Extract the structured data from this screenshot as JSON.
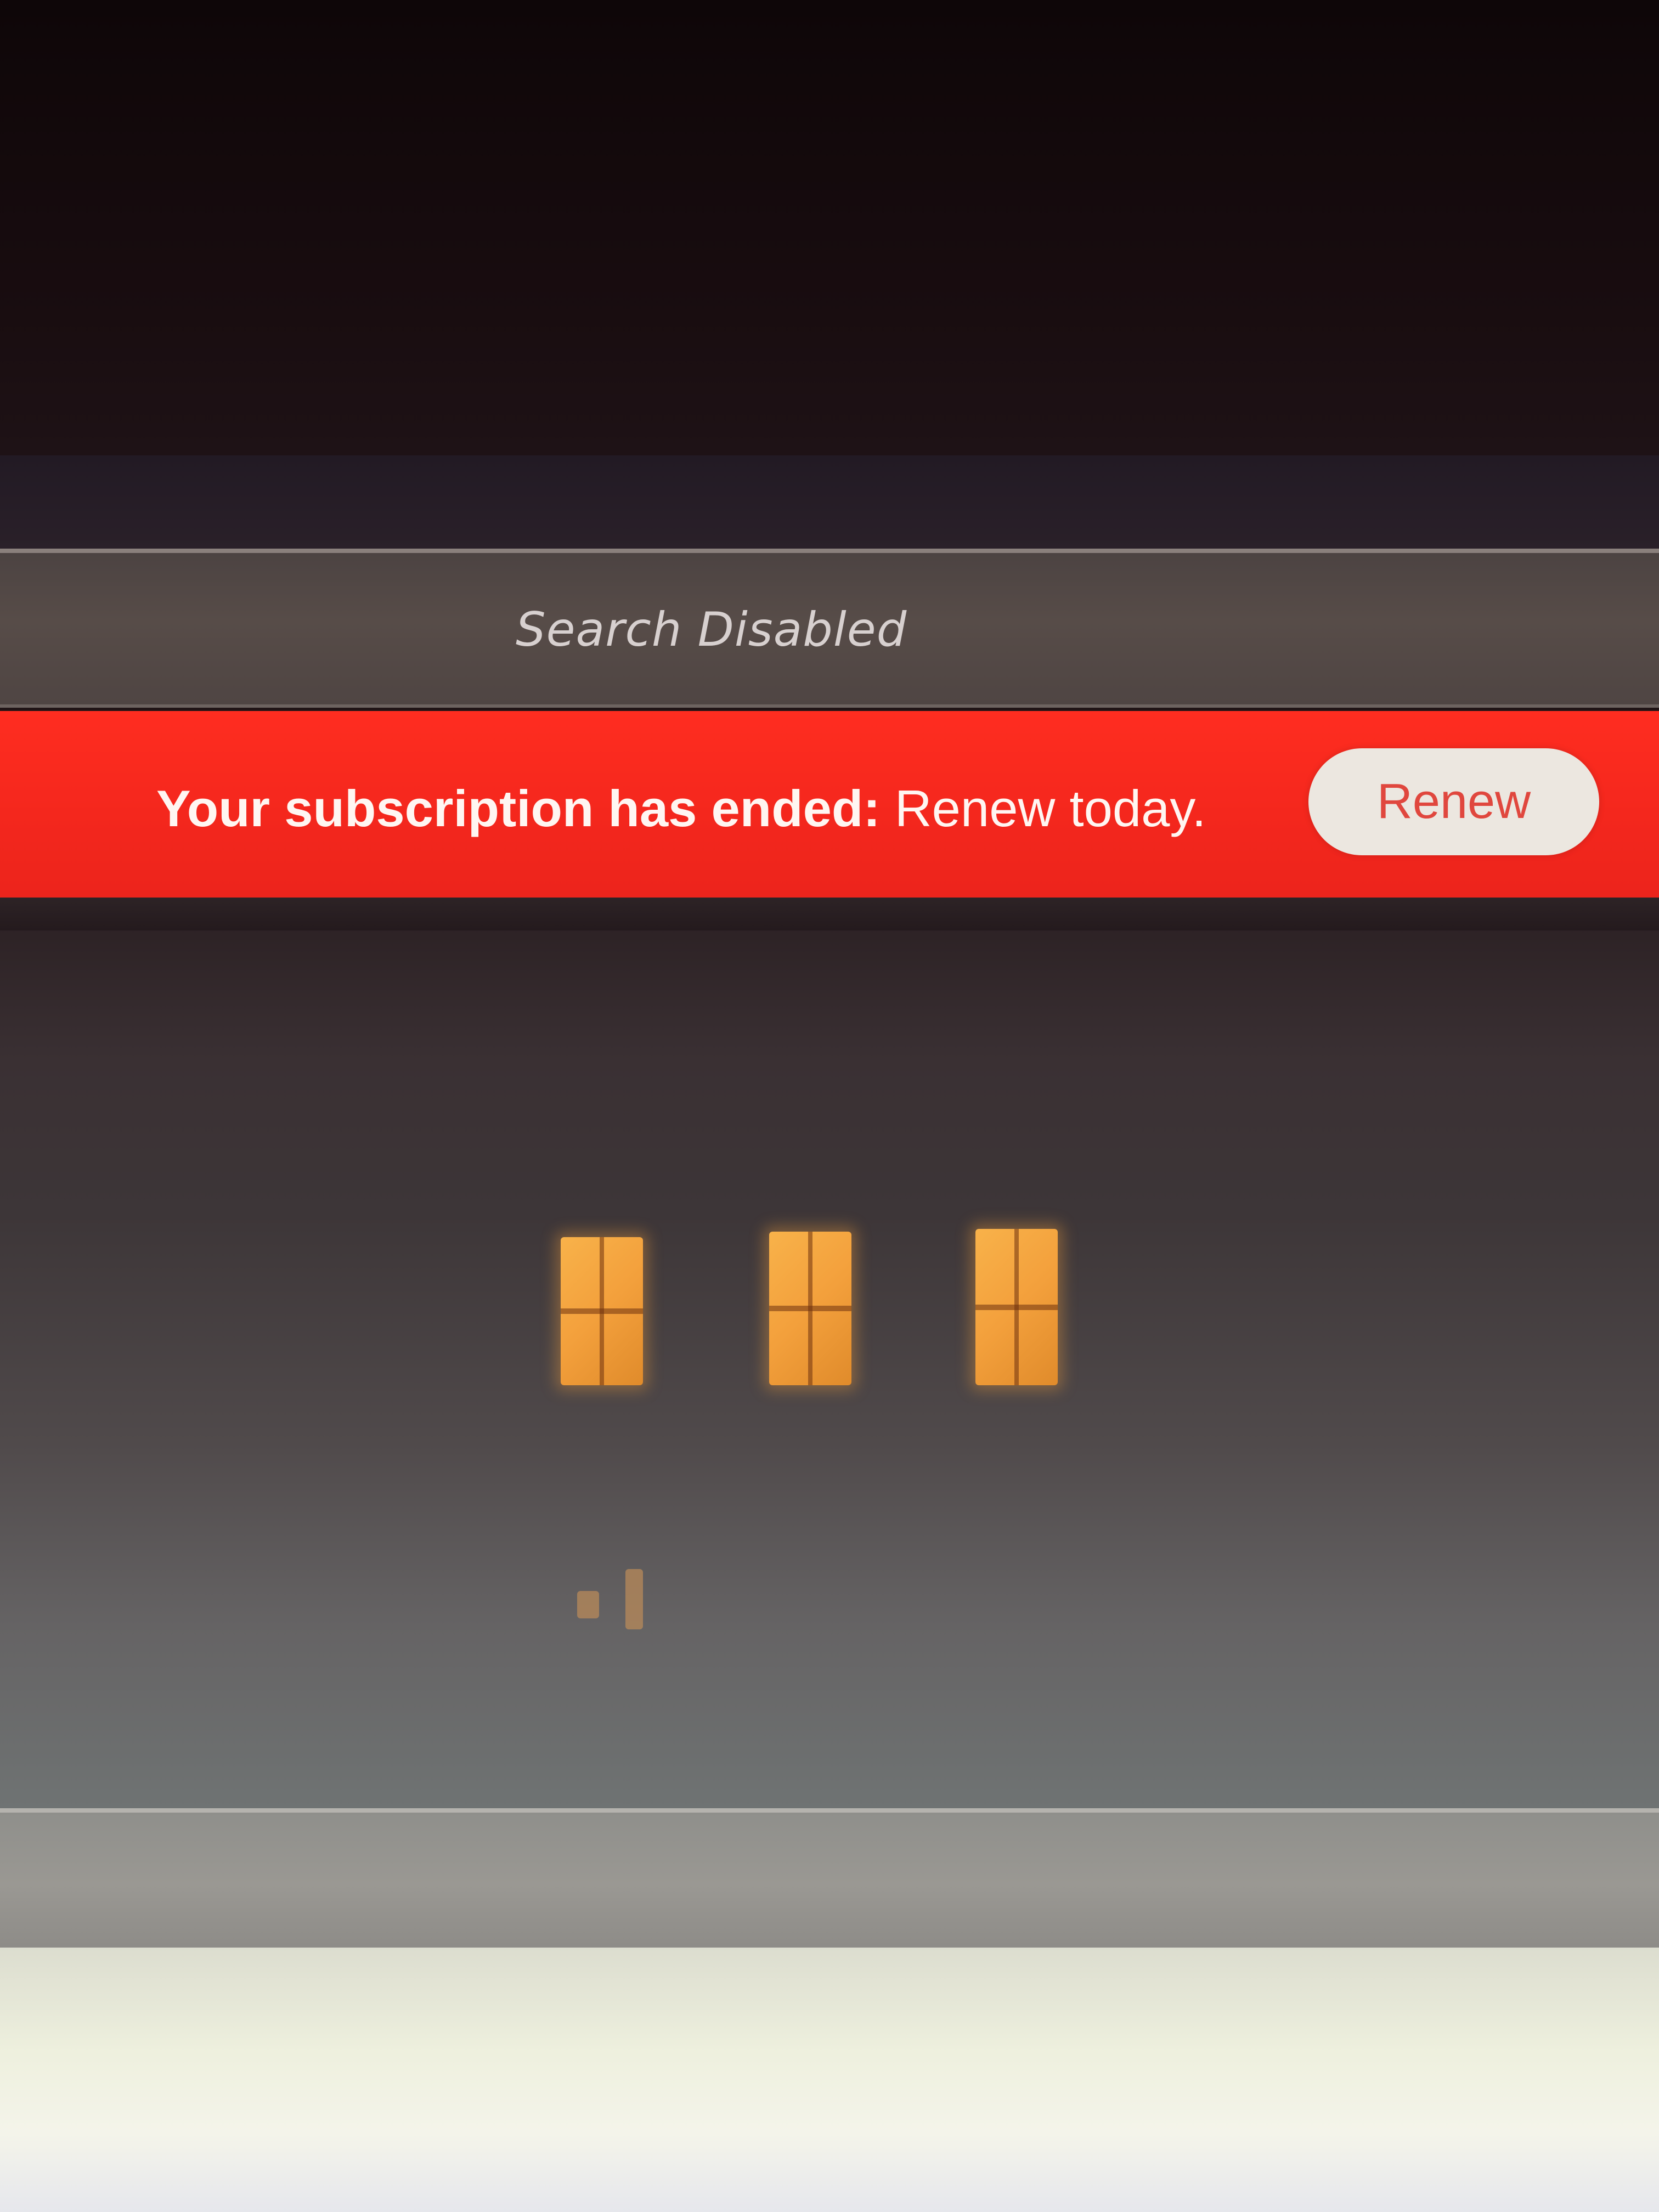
{
  "search": {
    "label": "Search Disabled"
  },
  "banner": {
    "message_bold": "Your subscription has ended:",
    "message_regular": " Renew today.",
    "button_label": "Renew",
    "background_color": "#f4271d",
    "button_text_color": "#e0473e"
  }
}
